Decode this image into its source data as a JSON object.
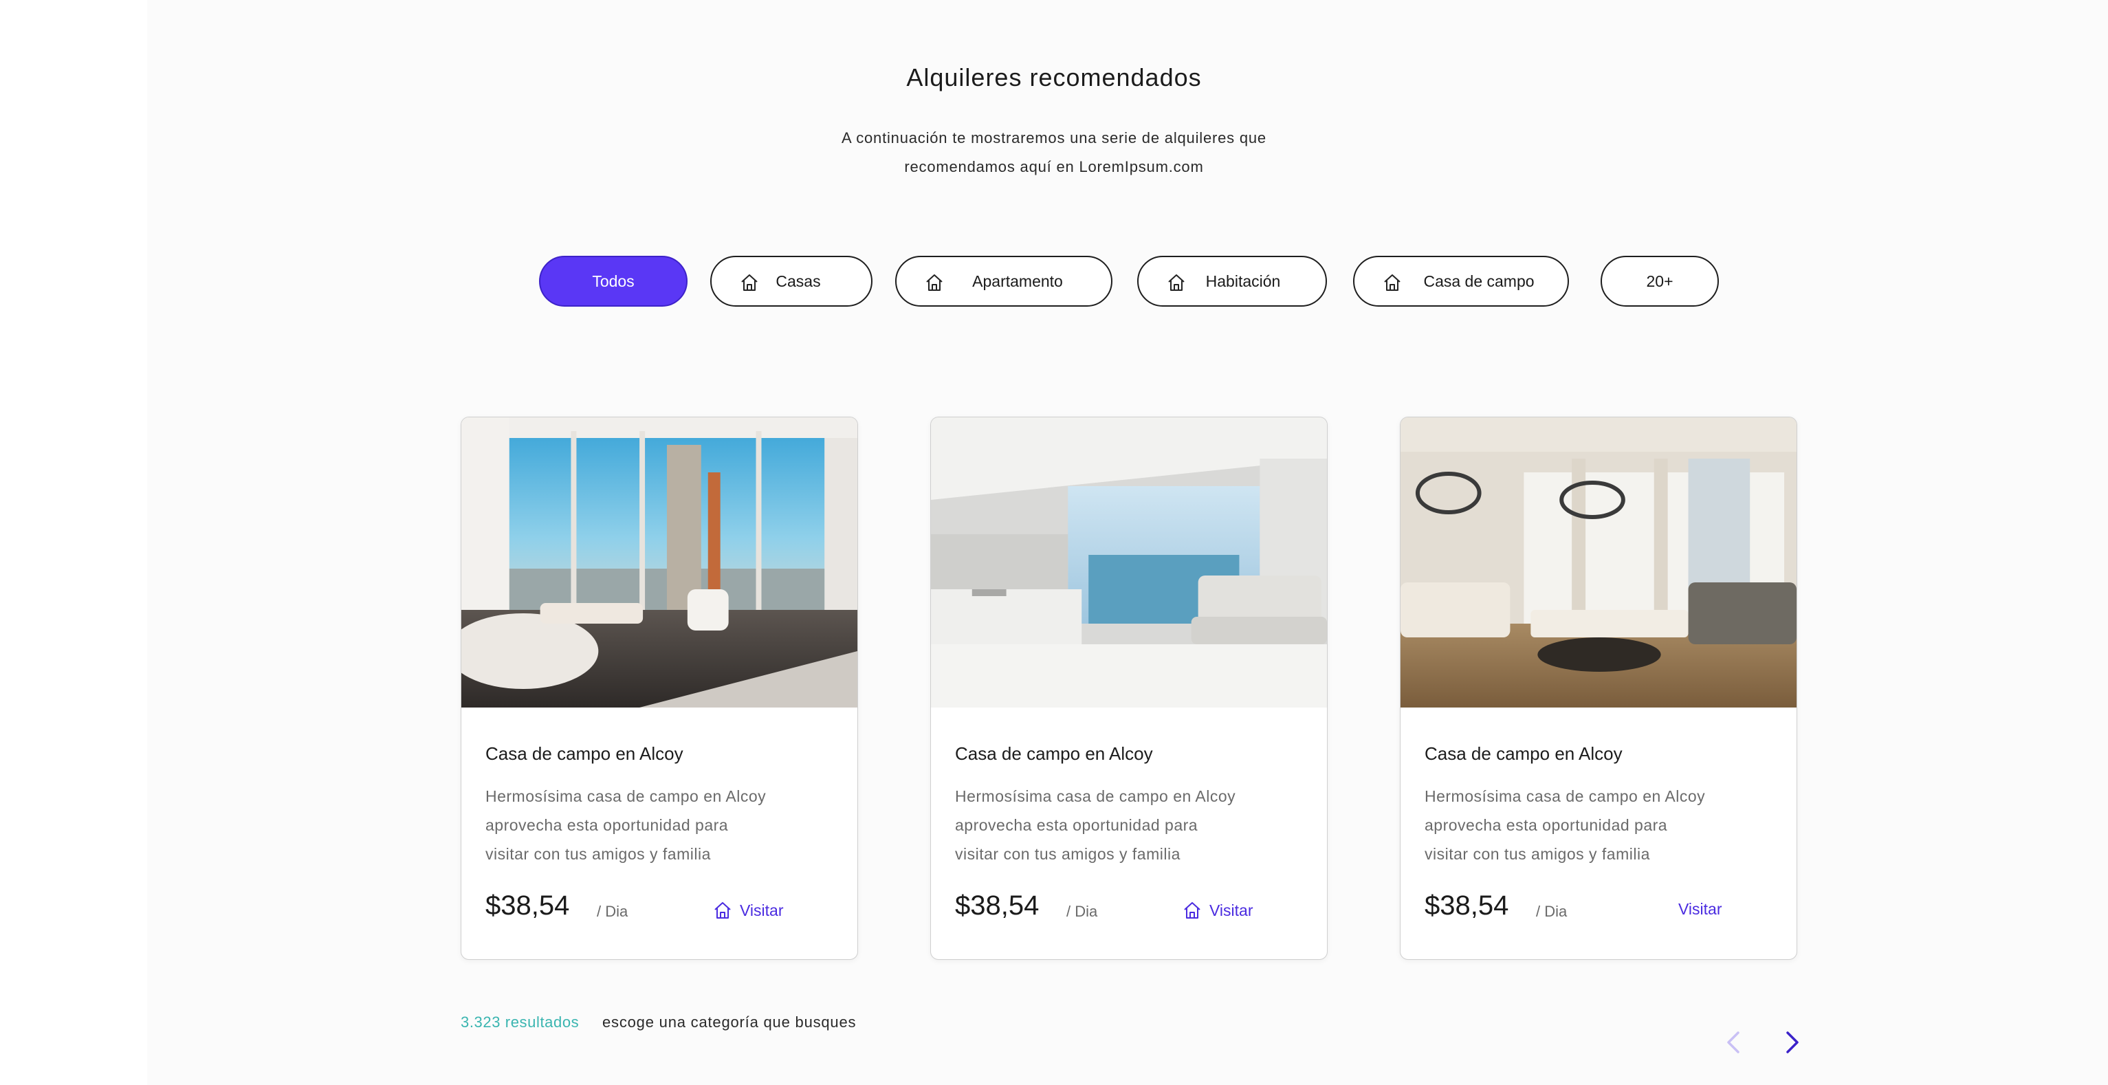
{
  "header": {
    "title": "Alquileres recomendados",
    "subtitle_line1": "A continuación te mostraremos una serie de alquileres que",
    "subtitle_line2": "recomendamos aquí en LoremIpsum.com"
  },
  "filters": [
    {
      "label": "Todos",
      "active": true,
      "icon": null
    },
    {
      "label": "Casas",
      "active": false,
      "icon": "house-icon"
    },
    {
      "label": "Apartamento",
      "active": false,
      "icon": "house-icon"
    },
    {
      "label": "Habitación",
      "active": false,
      "icon": "house-icon"
    },
    {
      "label": "Casa de campo",
      "active": false,
      "icon": "house-icon"
    },
    {
      "label": "20+",
      "active": false,
      "icon": null
    }
  ],
  "cards": [
    {
      "title": "Casa de campo en Alcoy",
      "desc_line1": "Hermosísima casa de campo en Alcoy",
      "desc_line2": "aprovecha esta oportunidad para",
      "desc_line3": "visitar con tus amigos y familia",
      "price": "$38,54",
      "per": "/ Dia",
      "visit_label": "Visitar",
      "visit_icon": "house-icon"
    },
    {
      "title": "Casa de campo en Alcoy",
      "desc_line1": "Hermosísima casa de campo en Alcoy",
      "desc_line2": "aprovecha esta oportunidad para",
      "desc_line3": "visitar con tus amigos y familia",
      "price": "$38,54",
      "per": "/ Dia",
      "visit_label": "Visitar",
      "visit_icon": "house-icon"
    },
    {
      "title": "Casa de campo en Alcoy",
      "desc_line1": "Hermosísima casa de campo en Alcoy",
      "desc_line2": "aprovecha esta oportunidad para",
      "desc_line3": "visitar con tus amigos y familia",
      "price": "$38,54",
      "per": "/ Dia",
      "visit_label": "Visitar",
      "visit_icon": null
    }
  ],
  "footer": {
    "results": "3.323 resultados",
    "hint": "escoge una categoría que busques"
  },
  "colors": {
    "accent": "#5a37f5",
    "link": "#4a2be0",
    "results": "#3ab5b0"
  }
}
